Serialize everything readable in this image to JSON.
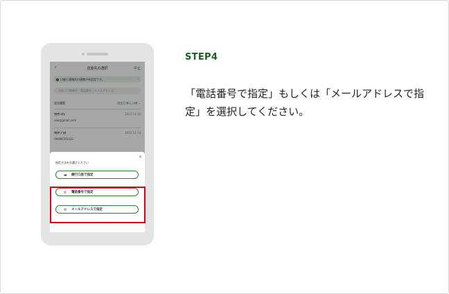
{
  "step_label": "STEP4",
  "description": "「電話番号で指定」もしくは「メールアドレスで指定」を選択してください。",
  "colors": {
    "accent": "#1b5e20",
    "highlight": "#e00012"
  },
  "phone": {
    "header_title": "送金先の選択",
    "header_back": "‹",
    "header_cancel": "中止",
    "notice": "口座と連絡先の連携が未設定です。",
    "notice_arrow": "›",
    "search_placeholder": "名前・口座番号・電話番号・メールアドレス",
    "sort_left": "送金履歴",
    "sort_right": "送金日 新しい順 ⌄",
    "recipients": [
      {
        "name": "ﾜｶｸｻ ﾊﾅｺ",
        "date": "2022.12.16",
        "detail": "aaa@gmail.com"
      },
      {
        "name": "ﾜｶｸｻ ｼﾞﾛｳ",
        "date": "2022.12.14",
        "detail": "09098765432"
      }
    ],
    "sheet": {
      "close": "×",
      "title": "指定方法をお選びください",
      "options": [
        {
          "label": "銀行口座で指定",
          "icon": "card-icon"
        },
        {
          "label": "電話番号で指定",
          "icon": "phone-icon"
        },
        {
          "label": "メールアドレスで指定",
          "icon": "mail-icon"
        }
      ]
    }
  }
}
